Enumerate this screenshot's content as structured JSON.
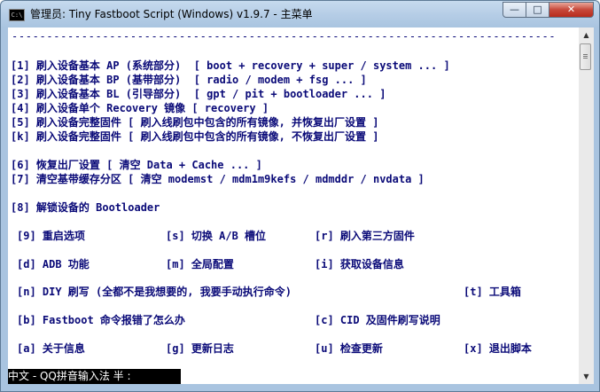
{
  "window": {
    "title": "管理员:  Tiny Fastboot Script (Windows) v1.9.7 - 主菜单",
    "icon_text": "C:\\",
    "minimize_glyph": "—",
    "maximize_glyph": "□",
    "close_glyph": "✕"
  },
  "console": {
    "separator": "------------------------------------------------------------------------------",
    "lines": [
      "[1] 刷入设备基本 AP (系统部分)  [ boot + recovery + super / system ... ]",
      "[2] 刷入设备基本 BP (基带部分)  [ radio / modem + fsg ... ]",
      "[3] 刷入设备基本 BL (引导部分)  [ gpt / pit + bootloader ... ]",
      "[4] 刷入设备单个 Recovery 镜像 [ recovery ]",
      "[5] 刷入设备完整固件 [ 刷入线刷包中包含的所有镜像, 并恢复出厂设置 ]",
      "[k] 刷入设备完整固件 [ 刷入线刷包中包含的所有镜像, 不恢复出厂设置 ]",
      "[6] 恢复出厂设置 [ 清空 Data + Cache ... ]",
      "[7] 清空基带缓存分区 [ 清空 modemst / mdm1m9kefs / mdmddr / nvdata ]",
      "[8] 解锁设备的 Bootloader"
    ],
    "grid": [
      [
        "[9] 重启选项",
        "[s] 切换 A/B 槽位",
        "[r] 刷入第三方固件"
      ],
      [
        "[d] ADB 功能",
        "[m] 全局配置",
        "[i] 获取设备信息"
      ],
      [
        "[n] DIY 刷写 (全都不是我想要的, 我要手动执行命令)",
        "[t] 工具箱"
      ],
      [
        "[b] Fastboot 命令报错了怎么办",
        "[c] CID 及固件刷写说明"
      ],
      [
        "[a] 关于信息",
        "[g] 更新日志",
        "[u] 检查更新",
        "[x] 退出脚本"
      ]
    ]
  },
  "ime_status": "中文 - QQ拼音输入法 半 :",
  "scrollbar": {
    "up_glyph": "▲",
    "down_glyph": "▼"
  }
}
